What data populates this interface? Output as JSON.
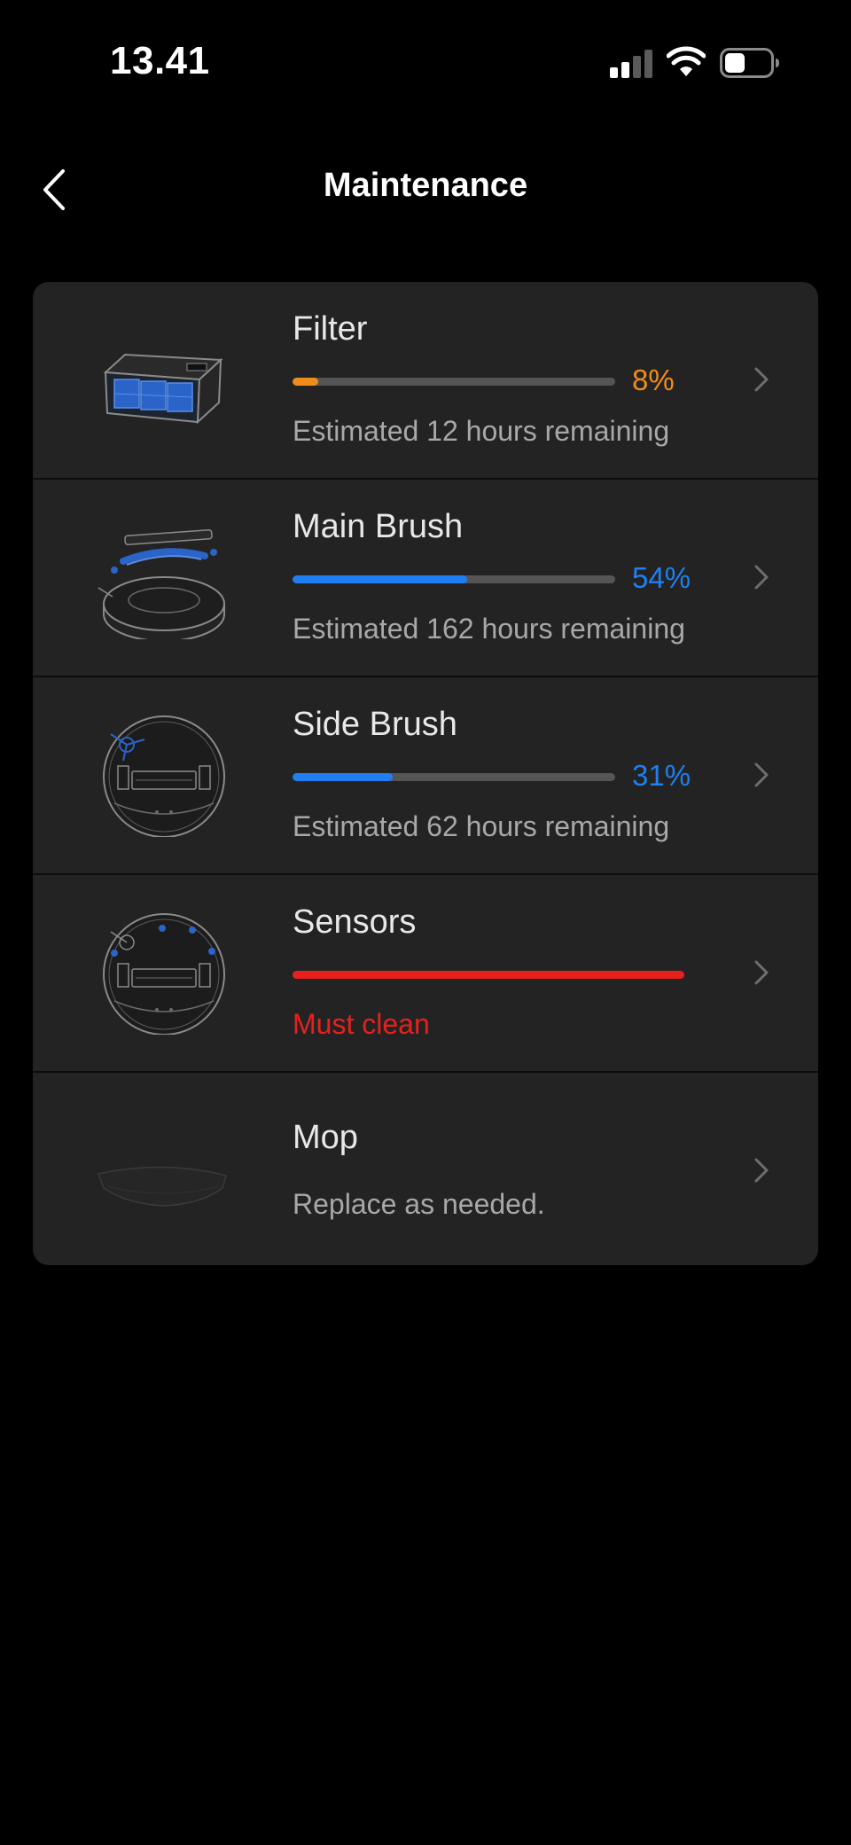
{
  "status_bar": {
    "time": "13.41",
    "signal_icon": "cellular-signal-icon",
    "wifi_icon": "wifi-icon",
    "battery_icon": "battery-icon"
  },
  "header": {
    "back_icon": "chevron-left-icon",
    "title": "Maintenance"
  },
  "colors": {
    "background": "#000000",
    "card": "#232323",
    "orange": "#f08c1c",
    "blue": "#1f7ff2",
    "red": "#e8201c",
    "track": "#555555"
  },
  "items": [
    {
      "name": "Filter",
      "percent_label": "8%",
      "progress": 0.08,
      "color": "#f08c1c",
      "subtitle": "Estimated 12 hours remaining",
      "image": "filter-image"
    },
    {
      "name": "Main Brush",
      "percent_label": "54%",
      "progress": 0.54,
      "color": "#1f7ff2",
      "subtitle": "Estimated 162 hours remaining",
      "image": "main-brush-image"
    },
    {
      "name": "Side Brush",
      "percent_label": "31%",
      "progress": 0.31,
      "color": "#1f7ff2",
      "subtitle": "Estimated 62 hours remaining",
      "image": "side-brush-image"
    },
    {
      "name": "Sensors",
      "progress": 1.0,
      "color": "#e8201c",
      "subtitle": "Must clean",
      "image": "sensors-image"
    },
    {
      "name": "Mop",
      "subtitle": "Replace as needed.",
      "image": "mop-image"
    }
  ]
}
